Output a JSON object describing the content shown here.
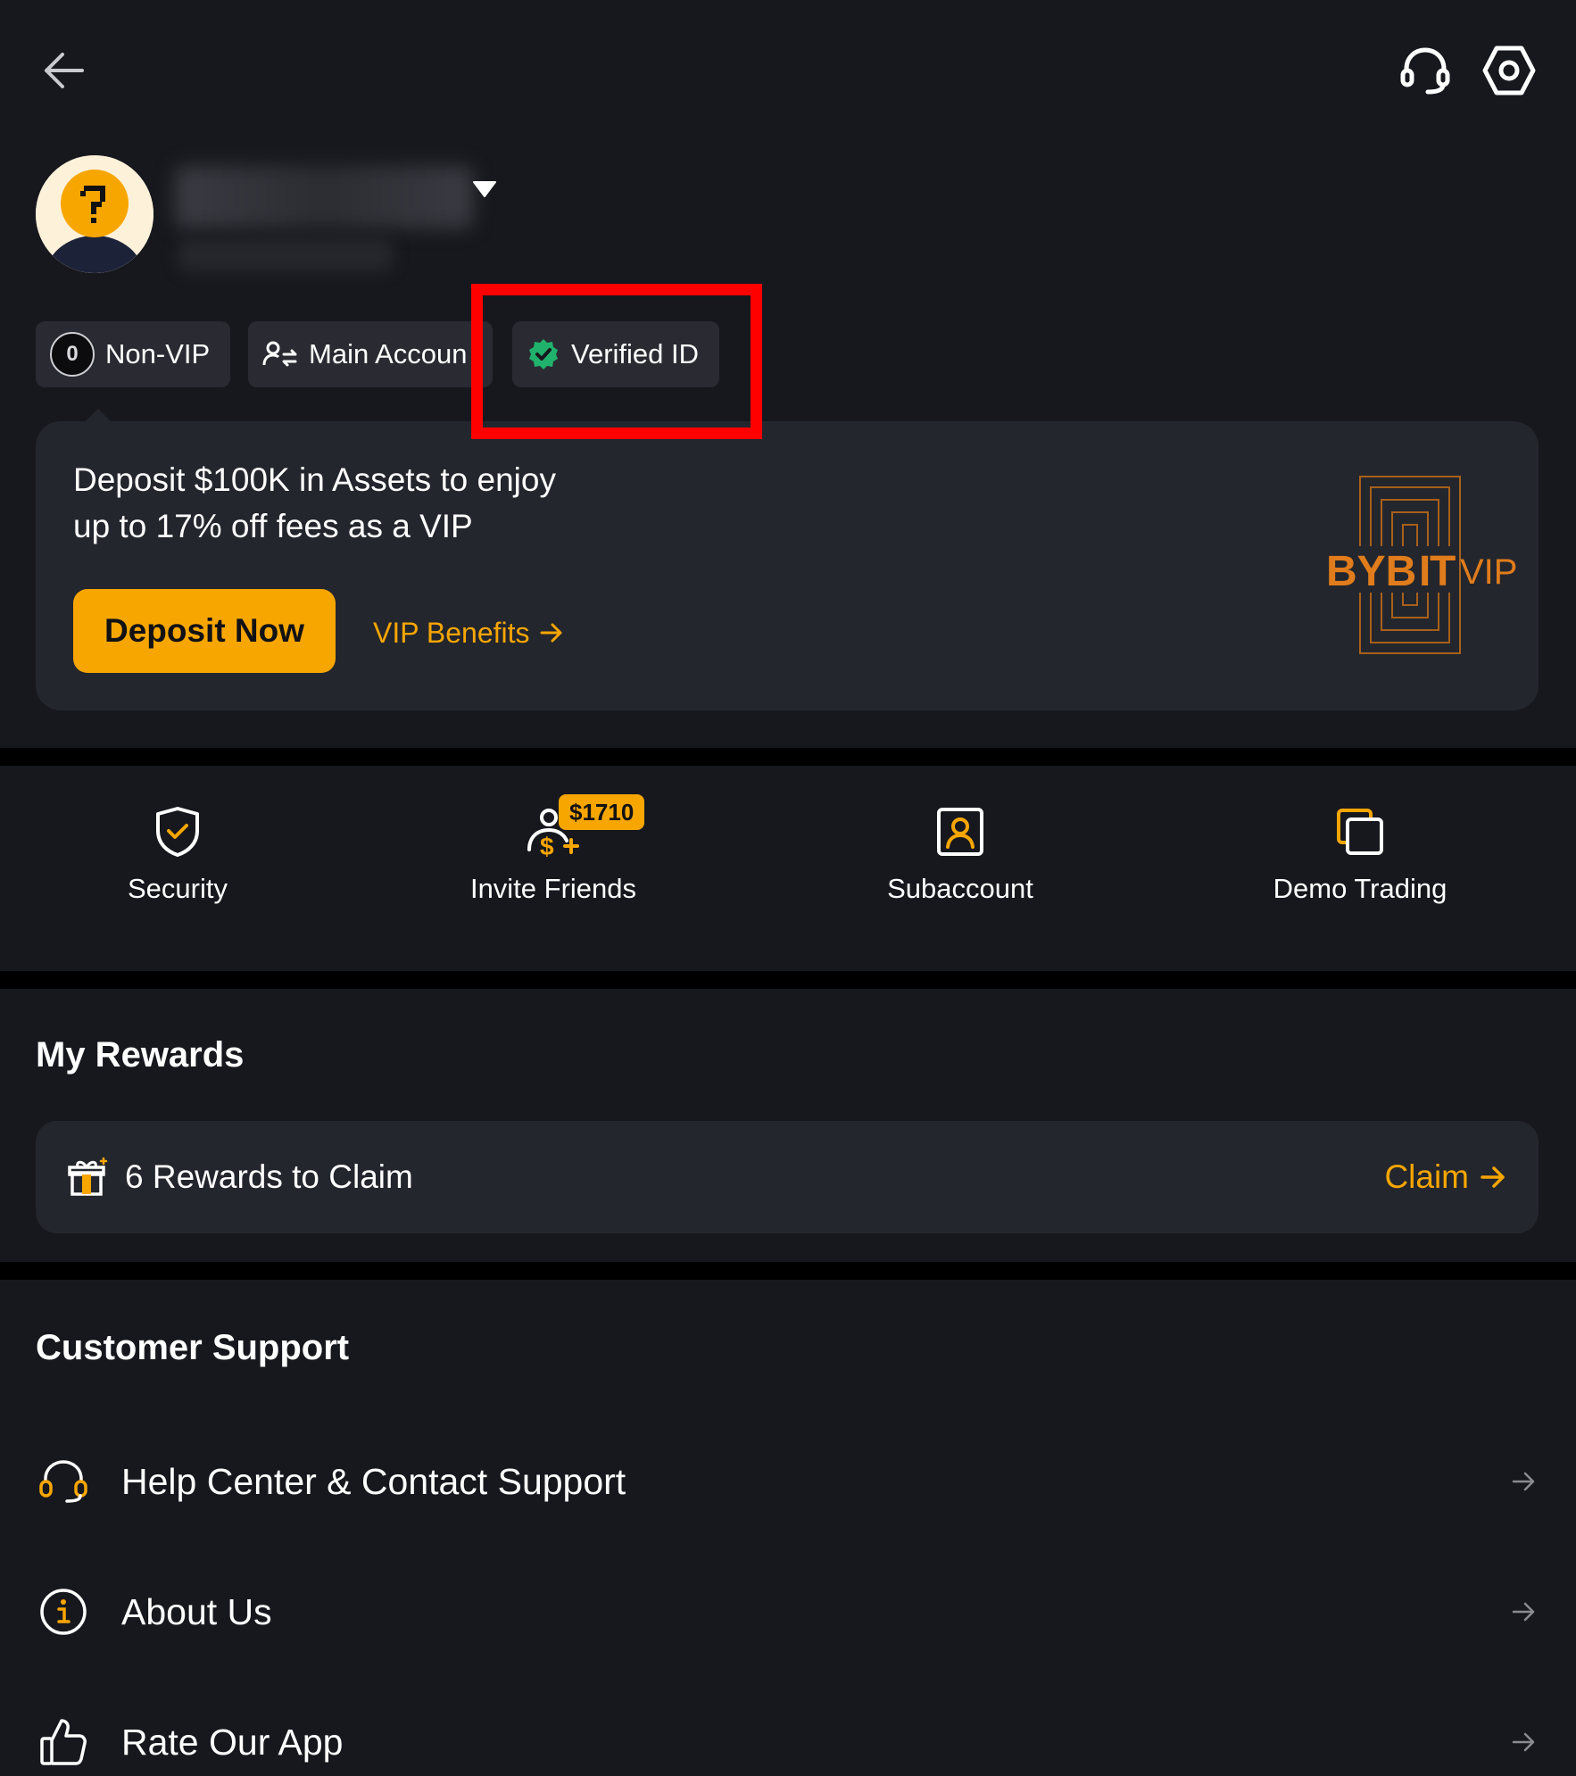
{
  "header": {
    "back_icon": "arrow-left-icon",
    "support_icon": "headset-icon",
    "settings_icon": "gear-icon"
  },
  "profile": {
    "avatar_icon": "question-mark-avatar-icon",
    "dropdown_icon": "caret-down-icon"
  },
  "badges": {
    "vip_level_glyph": "0",
    "vip_label": "Non-VIP",
    "account_label": "Main Accoun",
    "verified_label": "Verified ID"
  },
  "vip_card": {
    "message_line1": "Deposit $100K in Assets to enjoy",
    "message_line2": "up to 17% off fees as a VIP",
    "deposit_button": "Deposit Now",
    "benefits_link": "VIP Benefits",
    "logo_text_main": "BYB",
    "logo_text_i": "I",
    "logo_text_t": "T",
    "logo_text_vip": "VIP"
  },
  "quick_actions": [
    {
      "label": "Security",
      "icon": "shield-check-icon"
    },
    {
      "label": "Invite Friends",
      "icon": "person-dollar-icon",
      "badge": "$1710"
    },
    {
      "label": "Subaccount",
      "icon": "user-square-icon"
    },
    {
      "label": "Demo Trading",
      "icon": "stacked-squares-icon"
    }
  ],
  "rewards": {
    "title": "My Rewards",
    "text": "6 Rewards to Claim",
    "claim": "Claim"
  },
  "support": {
    "title": "Customer Support",
    "items": [
      {
        "label": "Help Center & Contact Support",
        "icon": "headset-icon"
      },
      {
        "label": "About Us",
        "icon": "info-icon"
      },
      {
        "label": "Rate Our App",
        "icon": "thumbs-up-icon"
      }
    ]
  },
  "colors": {
    "background": "#17181e",
    "card": "#24262d",
    "accent": "#f7a600",
    "verified_green": "#20b26c",
    "highlight": "#ff0000"
  }
}
